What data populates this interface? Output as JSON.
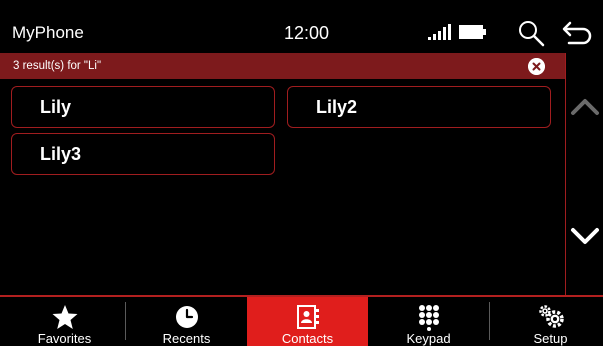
{
  "status_bar": {
    "app_title": "MyPhone",
    "time": "12:00",
    "icons": [
      "signal-icon",
      "battery-icon",
      "search-icon",
      "back-icon"
    ]
  },
  "search": {
    "results_text": "3 result(s) for \"Li\"",
    "clear_icon": "clear-circle-x-icon"
  },
  "contacts": [
    {
      "name": "Lily"
    },
    {
      "name": "Lily2"
    },
    {
      "name": "Lily3"
    }
  ],
  "scroll": {
    "up_icon": "chevron-up-icon",
    "down_icon": "chevron-down-icon"
  },
  "nav": {
    "items": [
      {
        "label": "Favorites",
        "icon": "star-icon",
        "active": false
      },
      {
        "label": "Recents",
        "icon": "clock-icon",
        "active": false
      },
      {
        "label": "Contacts",
        "icon": "address-book-icon",
        "active": true
      },
      {
        "label": "Keypad",
        "icon": "keypad-icon",
        "active": false
      },
      {
        "label": "Setup",
        "icon": "gears-icon",
        "active": false
      }
    ]
  },
  "colors": {
    "accent": "#e01e1c",
    "results_bar": "#7d1a1c",
    "border": "#a01d1f",
    "background": "#000000"
  }
}
